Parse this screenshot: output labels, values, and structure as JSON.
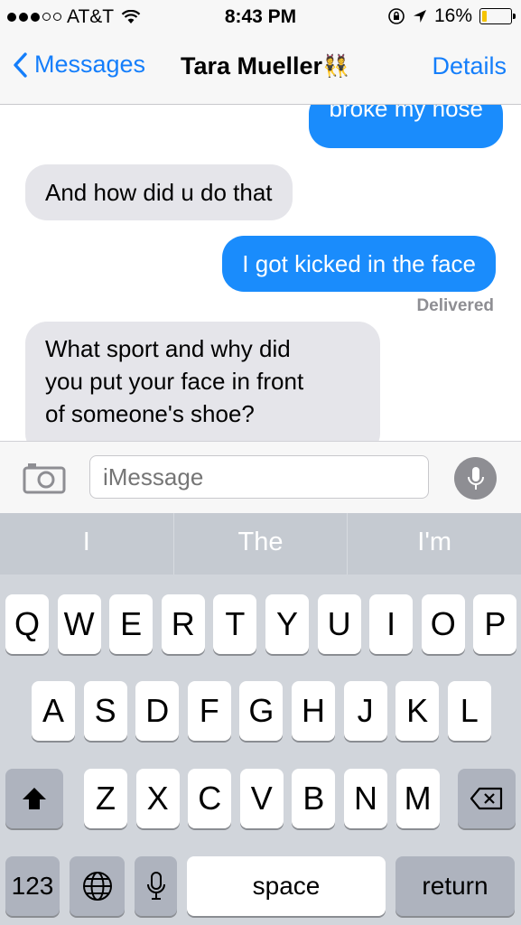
{
  "status_bar": {
    "carrier": "AT&T",
    "time": "8:43 PM",
    "battery": "16%",
    "battery_level": 0.16
  },
  "nav": {
    "back_label": "Messages",
    "contact_name": "Tara Mueller",
    "contact_emoji": "👯",
    "details_label": "Details"
  },
  "messages": [
    {
      "from": "me",
      "text": "broke my nose"
    },
    {
      "from": "them",
      "text": "And how did u do that"
    },
    {
      "from": "me",
      "text": "I got kicked in the face"
    },
    {
      "from": "them",
      "lines": [
        "What sport and why did",
        "you put your face in front",
        "of someone's shoe?"
      ]
    }
  ],
  "delivered_label": "Delivered",
  "input": {
    "placeholder": "iMessage"
  },
  "predictions": [
    "I",
    "The",
    "I'm"
  ],
  "keyboard": {
    "row1": [
      "Q",
      "W",
      "E",
      "R",
      "T",
      "Y",
      "U",
      "I",
      "O",
      "P"
    ],
    "row2": [
      "A",
      "S",
      "D",
      "F",
      "G",
      "H",
      "J",
      "K",
      "L"
    ],
    "row3": [
      "Z",
      "X",
      "C",
      "V",
      "B",
      "N",
      "M"
    ],
    "numbers_label": "123",
    "space_label": "space",
    "return_label": "return"
  },
  "colors": {
    "accent": "#147efb",
    "outgoing_bubble": "#1a8cfc",
    "incoming_bubble": "#e5e5ea",
    "battery_fill": "#f5c400"
  },
  "icons": [
    "signal-dots-icon",
    "wifi-icon",
    "lock-rotation-icon",
    "location-arrow-icon",
    "battery-icon",
    "back-chevron-icon",
    "camera-icon",
    "microphone-icon",
    "shift-icon",
    "delete-icon",
    "globe-icon",
    "dictation-icon"
  ]
}
